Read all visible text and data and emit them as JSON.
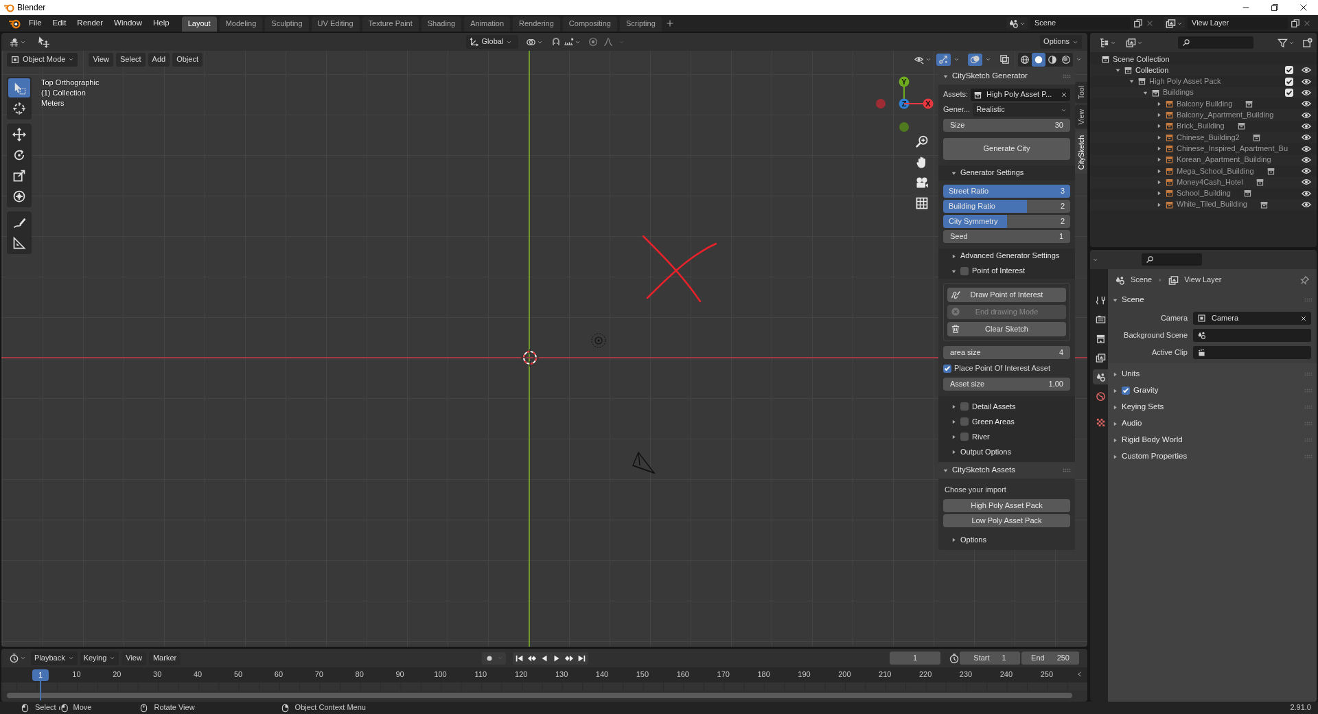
{
  "window": {
    "title": "Blender"
  },
  "menu": [
    "File",
    "Edit",
    "Render",
    "Window",
    "Help"
  ],
  "workspaces": [
    {
      "label": "Layout",
      "selected": true
    },
    {
      "label": "Modeling",
      "selected": false
    },
    {
      "label": "Sculpting",
      "selected": false
    },
    {
      "label": "UV Editing",
      "selected": false
    },
    {
      "label": "Texture Paint",
      "selected": false
    },
    {
      "label": "Shading",
      "selected": false
    },
    {
      "label": "Animation",
      "selected": false
    },
    {
      "label": "Rendering",
      "selected": false
    },
    {
      "label": "Compositing",
      "selected": false
    },
    {
      "label": "Scripting",
      "selected": false
    }
  ],
  "scene": {
    "name": "Scene"
  },
  "view_layer": {
    "name": "View Layer"
  },
  "tool_header": {
    "orientation": "Global",
    "options": "Options"
  },
  "viewport_header": {
    "mode": "Object Mode",
    "menus": [
      "View",
      "Select",
      "Add",
      "Object"
    ],
    "shading": [
      {
        "kind": "wireframe",
        "selected": false
      },
      {
        "kind": "solid",
        "selected": true
      },
      {
        "kind": "material",
        "selected": false
      },
      {
        "kind": "rendered",
        "selected": false
      }
    ]
  },
  "tools": [
    {
      "kind": "select",
      "selected": true
    },
    {
      "kind": "cursor",
      "selected": false
    },
    {
      "kind": "move",
      "selected": false
    },
    {
      "kind": "rotate",
      "selected": false
    },
    {
      "kind": "scale",
      "selected": false
    },
    {
      "kind": "transform",
      "selected": false
    },
    {
      "kind": "annotate",
      "selected": false
    },
    {
      "kind": "measure",
      "selected": false
    }
  ],
  "overlay_text": [
    "Top Orthographic",
    "(1) Collection",
    "Meters"
  ],
  "gizmo": {
    "axes": [
      {
        "label": "Y",
        "kind": "y"
      },
      {
        "label": "Z",
        "kind": "z"
      },
      {
        "label": "X",
        "kind": "x"
      }
    ]
  },
  "sidebar_tabs": [
    {
      "label": "Tool",
      "selected": false
    },
    {
      "label": "View",
      "selected": false
    },
    {
      "label": "CitySketch",
      "selected": true
    }
  ],
  "generator_panel": {
    "title": "CitySketch Generator",
    "expanded": true,
    "assets": {
      "label": "Assets:",
      "value": "High Poly Asset P..."
    },
    "generator": {
      "label": "Gener...",
      "value": "Realistic"
    },
    "size": {
      "label": "Size",
      "value": "30"
    },
    "generate_button": "Generate City",
    "settings": {
      "title": "Generator Settings",
      "expanded": true,
      "fields": [
        {
          "label": "Street Ratio",
          "value": "3",
          "kind": "slider",
          "level": 1
        },
        {
          "label": "Building Ratio",
          "value": "2",
          "kind": "slider",
          "level": 0.66
        },
        {
          "label": "City Symmetry",
          "value": "2",
          "kind": "slider",
          "level": 0.5
        },
        {
          "label": "Seed",
          "value": "1",
          "kind": "number"
        }
      ]
    },
    "advanced": {
      "title": "Advanced Generator Settings",
      "expanded": false
    },
    "poi": {
      "title": "Point of Interest",
      "expanded": true,
      "checked": false,
      "buttons": [
        {
          "label": "Draw Point of Interest",
          "kind": "draw",
          "disabled": false
        },
        {
          "label": "End drawing Mode",
          "kind": "end",
          "disabled": true
        },
        {
          "label": "Clear Sketch",
          "kind": "clear",
          "disabled": false
        }
      ],
      "area_size": {
        "label": "area size",
        "value": "4"
      },
      "place_asset": {
        "label": "Place Point Of Interest Asset",
        "checked": true
      },
      "asset_size": {
        "label": "Asset size",
        "value": "1.00"
      }
    },
    "subpanels": [
      {
        "title": "Detail Assets",
        "expanded": false,
        "kind": "checkbox",
        "checked": false
      },
      {
        "title": "Green Areas",
        "expanded": false,
        "kind": "checkbox",
        "checked": false
      },
      {
        "title": "River",
        "expanded": false,
        "kind": "checkbox",
        "checked": false
      },
      {
        "title": "Output Options",
        "expanded": false,
        "kind": "plain"
      }
    ]
  },
  "assets_panel": {
    "title": "CitySketch Assets",
    "expanded": true,
    "prompt": "Chose your import",
    "buttons": [
      "High Poly Asset Pack",
      "Low Poly Asset Pack"
    ],
    "options": {
      "title": "Options",
      "expanded": false
    }
  },
  "outliner": {
    "root": "Scene Collection",
    "tree": [
      {
        "label": "Collection",
        "kind": "collection",
        "expanded": true,
        "checked": true,
        "children": [
          {
            "label": "High Poly Asset Pack",
            "kind": "collection",
            "expanded": true,
            "checked": true,
            "children": [
              {
                "label": "Buildings",
                "kind": "collection",
                "expanded": true,
                "checked": true,
                "children": [
                  {
                    "label": "Balcony Building",
                    "kind": "object",
                    "expanded": false,
                    "instance": true
                  },
                  {
                    "label": "Balcony_Apartment_Building",
                    "kind": "object",
                    "expanded": false,
                    "instance": false
                  },
                  {
                    "label": "Brick_Building",
                    "kind": "object",
                    "expanded": false,
                    "instance": true
                  },
                  {
                    "label": "Chinese_Building2",
                    "kind": "object",
                    "expanded": false,
                    "instance": true
                  },
                  {
                    "label": "Chinese_Inspired_Apartment_Bu",
                    "kind": "object",
                    "expanded": false,
                    "instance": false
                  },
                  {
                    "label": "Korean_Apartment_Building",
                    "kind": "object",
                    "expanded": false,
                    "instance": false
                  },
                  {
                    "label": "Mega_School_Building",
                    "kind": "object",
                    "expanded": false,
                    "instance": true
                  },
                  {
                    "label": "Money4Cash_Hotel",
                    "kind": "object",
                    "expanded": false,
                    "instance": true
                  },
                  {
                    "label": "School_Building",
                    "kind": "object",
                    "expanded": false,
                    "instance": true
                  },
                  {
                    "label": "White_Tiled_Building",
                    "kind": "object",
                    "expanded": false,
                    "instance": true
                  }
                ]
              }
            ]
          }
        ]
      }
    ]
  },
  "properties": {
    "tabs": [
      {
        "kind": "tool",
        "selected": false
      },
      {
        "kind": "render",
        "selected": false
      },
      {
        "kind": "output",
        "selected": false
      },
      {
        "kind": "view_layer",
        "selected": false
      },
      {
        "kind": "scene",
        "selected": true
      },
      {
        "kind": "world",
        "selected": false
      },
      {
        "kind": "texture",
        "selected": false
      }
    ],
    "breadcrumb": [
      "Scene",
      "View Layer"
    ],
    "panel": {
      "title": "Scene",
      "expanded": true,
      "fields": [
        {
          "label": "Camera",
          "value": "Camera",
          "kind": "camera"
        },
        {
          "label": "Background Scene",
          "kind": "scene"
        },
        {
          "label": "Active Clip",
          "kind": "clip"
        }
      ]
    },
    "subpanels": [
      {
        "title": "Units",
        "expanded": false,
        "kind": "plain"
      },
      {
        "title": "Gravity",
        "expanded": false,
        "kind": "checkbox",
        "checked": true
      },
      {
        "title": "Keying Sets",
        "expanded": false,
        "kind": "plain"
      },
      {
        "title": "Audio",
        "expanded": false,
        "kind": "plain"
      },
      {
        "title": "Rigid Body World",
        "expanded": false,
        "kind": "plain"
      },
      {
        "title": "Custom Properties",
        "expanded": false,
        "kind": "plain"
      }
    ]
  },
  "timeline": {
    "menus": [
      "Playback",
      "Keying",
      "View",
      "Marker"
    ],
    "current_frame": "1",
    "start": {
      "label": "Start",
      "value": "1"
    },
    "end": {
      "label": "End",
      "value": "250"
    },
    "playhead": "1",
    "ticks": [
      "10",
      "20",
      "30",
      "40",
      "50",
      "60",
      "70",
      "80",
      "90",
      "100",
      "110",
      "120",
      "130",
      "140",
      "150",
      "160",
      "170",
      "180",
      "190",
      "200",
      "210",
      "220",
      "230",
      "240",
      "250"
    ]
  },
  "status_bar": {
    "hints": [
      {
        "kind": "lmb",
        "label": "Select"
      },
      {
        "kind": "drag",
        "label": "Move"
      },
      {
        "kind": "mmb",
        "label": "Rotate View"
      },
      {
        "kind": "rmb",
        "label": "Object Context Menu"
      }
    ],
    "version": "2.91.0"
  }
}
